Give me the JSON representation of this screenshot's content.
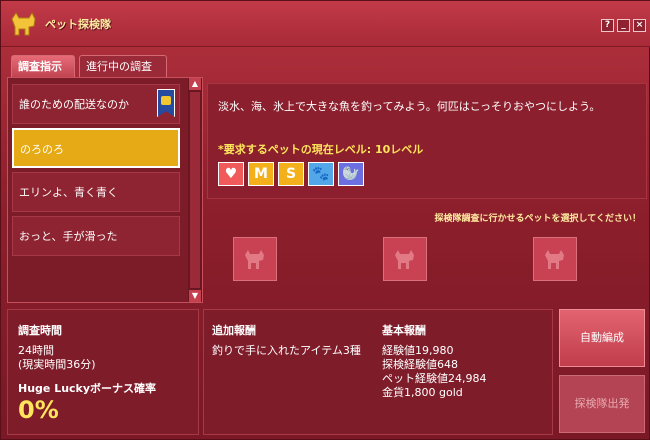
{
  "window": {
    "title": "ペット探検隊"
  },
  "tabs": [
    {
      "label": "調査指示"
    },
    {
      "label": "進行中の調査"
    }
  ],
  "missions": [
    {
      "label": "誰のための配送なのか"
    },
    {
      "label": "のろのろ"
    },
    {
      "label": "エリンよ、青く青く"
    },
    {
      "label": "おっと、手が滑った"
    }
  ],
  "detail": {
    "description": "淡水、海、氷上で大きな魚を釣ってみよう。何匹はこっそりおやつにしよう。",
    "requirement": "*要求するペットの現在レベル: 10レベル",
    "badges": [
      {
        "label": "♥",
        "color": "#f05a5a"
      },
      {
        "label": "M",
        "color": "#f4b01a"
      },
      {
        "label": "S",
        "color": "#f4b01a"
      },
      {
        "label": "🐾",
        "color": "#53a7e8"
      },
      {
        "label": "🦭",
        "color": "#6c6fe0"
      }
    ]
  },
  "pet_select_prompt": "探検隊調査に行かせるペットを選択してください！",
  "investigation": {
    "time_label": "調査時間",
    "time_value": "24時間",
    "real_time": "(現実時間36分)",
    "bonus_label": "Huge Luckyボーナス確率",
    "bonus_value": "0%"
  },
  "extra_reward": {
    "label": "追加報酬",
    "value": "釣りで手に入れたアイテム3種"
  },
  "base_reward": {
    "label": "基本報酬",
    "lines": [
      "経験値19,980",
      "探検経験値648",
      "ペット経験値24,984",
      "金貨1,800 gold"
    ]
  },
  "buttons": {
    "auto": "自動編成",
    "depart": "探検隊出発"
  },
  "colors": {
    "selected_item": "#e6aa16",
    "highlight_text": "#ffe55b"
  }
}
